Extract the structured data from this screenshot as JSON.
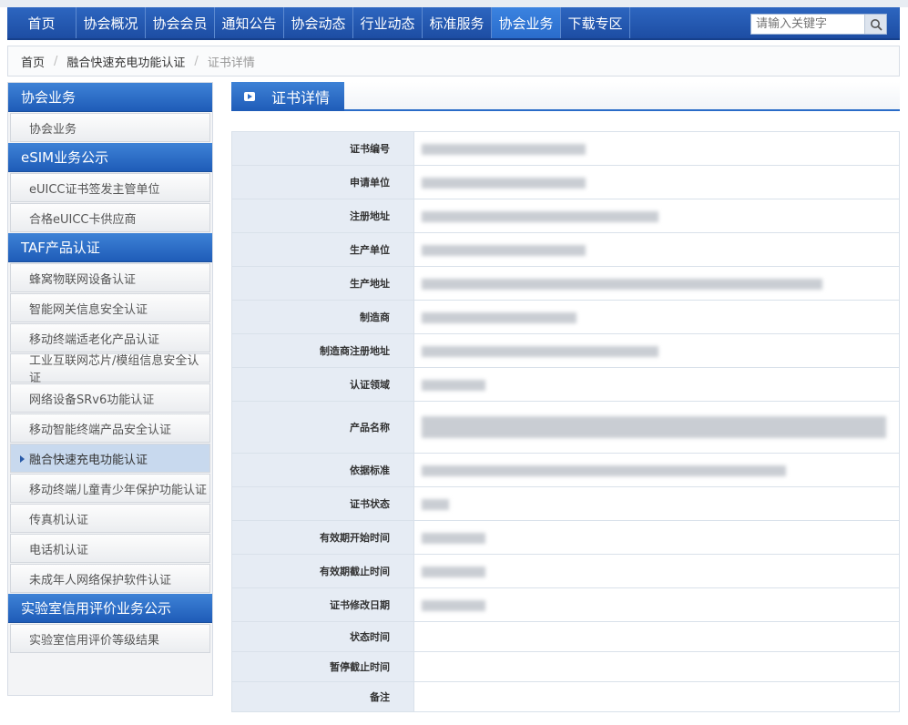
{
  "nav": {
    "items": [
      "首页",
      "协会概况",
      "协会会员",
      "通知公告",
      "协会动态",
      "行业动态",
      "标准服务",
      "协会业务",
      "下载专区"
    ],
    "active_index": 7,
    "search_placeholder": "请输入关键字",
    "search_icon": "search-icon"
  },
  "breadcrumb": {
    "home": "首页",
    "section": "融合快速充电功能认证",
    "current": "证书详情"
  },
  "sidebar": {
    "groups": [
      {
        "title": "协会业务",
        "items": [
          "协会业务"
        ]
      },
      {
        "title": "eSIM业务公示",
        "items": [
          "eUICC证书签发主管单位",
          "合格eUICC卡供应商"
        ]
      },
      {
        "title": "TAF产品认证",
        "items": [
          "蜂窝物联网设备认证",
          "智能网关信息安全认证",
          "移动终端适老化产品认证",
          "工业互联网芯片/模组信息安全认证",
          "网络设备SRv6功能认证",
          "移动智能终端产品安全认证",
          "融合快速充电功能认证",
          "移动终端儿童青少年保护功能认证",
          "传真机认证",
          "电话机认证",
          "未成年人网络保护软件认证"
        ]
      },
      {
        "title": "实验室信用评价业务公示",
        "items": [
          "实验室信用评价等级结果"
        ]
      }
    ],
    "active_item": "融合快速充电功能认证"
  },
  "main": {
    "title": "证书详情",
    "rows": [
      {
        "label": "证书编号"
      },
      {
        "label": "申请单位"
      },
      {
        "label": "注册地址"
      },
      {
        "label": "生产单位"
      },
      {
        "label": "生产地址"
      },
      {
        "label": "制造商"
      },
      {
        "label": "制造商注册地址"
      },
      {
        "label": "认证领域"
      },
      {
        "label": "产品名称"
      },
      {
        "label": "依据标准"
      },
      {
        "label": "证书状态"
      },
      {
        "label": "有效期开始时间"
      },
      {
        "label": "有效期截止时间"
      },
      {
        "label": "证书修改日期"
      },
      {
        "label": "状态时间"
      },
      {
        "label": "暂停截止时间"
      },
      {
        "label": "备注"
      }
    ]
  },
  "colors": {
    "nav_bg": "#1d4da3",
    "accent": "#2a6cc8",
    "label_bg": "#e6ecf4"
  }
}
